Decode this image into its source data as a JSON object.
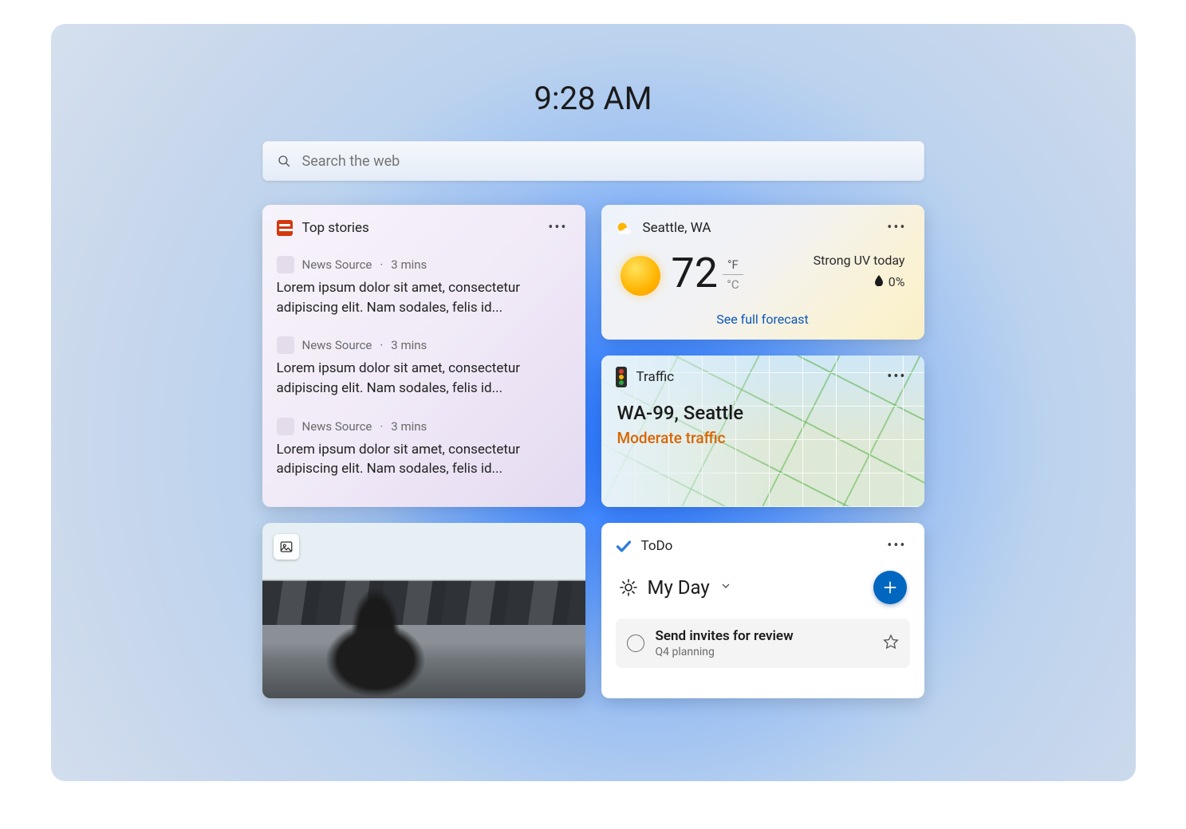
{
  "clock": "9:28 AM",
  "search": {
    "placeholder": "Search the web"
  },
  "news": {
    "title": "Top stories",
    "items": [
      {
        "source": "News Source",
        "age": "3 mins",
        "text": "Lorem ipsum dolor sit amet, consectetur adipiscing elit. Nam sodales, felis id..."
      },
      {
        "source": "News Source",
        "age": "3 mins",
        "text": "Lorem ipsum dolor sit amet, consectetur adipiscing elit. Nam sodales, felis id..."
      },
      {
        "source": "News Source",
        "age": "3 mins",
        "text": "Lorem ipsum dolor sit amet, consectetur adipiscing elit. Nam sodales, felis id..."
      }
    ]
  },
  "weather": {
    "location": "Seattle, WA",
    "icon": "sunny",
    "temp": "72",
    "unit_primary": "°F",
    "unit_secondary": "°C",
    "headline": "Strong UV today",
    "precip": "0%",
    "link": "See full forecast"
  },
  "traffic": {
    "title": "Traffic",
    "route": "WA-99, Seattle",
    "status": "Moderate traffic"
  },
  "todo": {
    "title": "ToDo",
    "list_label": "My Day",
    "tasks": [
      {
        "title": "Send invites for review",
        "sub": "Q4 planning"
      }
    ]
  }
}
